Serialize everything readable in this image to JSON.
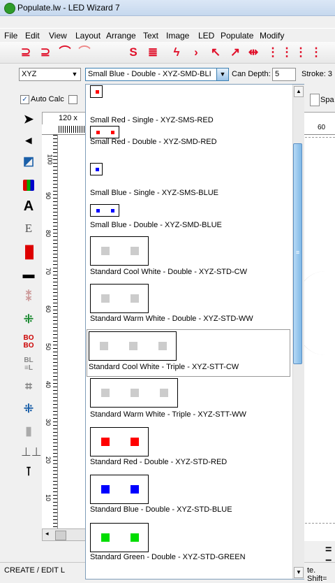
{
  "window": {
    "title": "Populate.lw - LED Wizard 7"
  },
  "menu": [
    "File",
    "Edit",
    "View",
    "Layout",
    "Arrange",
    "Text",
    "Image",
    "LED",
    "Populate",
    "Modify"
  ],
  "toolbar2": {
    "font_select": "XYZ",
    "led_select": "Small Blue - Double - XYZ-SMD-BLI",
    "can_depth_label": "Can Depth:",
    "can_depth_value": "5",
    "stroke_label": "Stroke: 3"
  },
  "toolbar3": {
    "auto_calc_label": "Auto Calc",
    "auto_calc_checked": "✓",
    "spa_label": "Spa"
  },
  "canvas": {
    "size_readout": "120 x",
    "ruler_h_label": "60",
    "ruler_v_labels": [
      "100",
      "90",
      "80",
      "70",
      "60",
      "50",
      "40",
      "30",
      "20",
      "10"
    ]
  },
  "statusbar": {
    "left_text": "CREATE / EDIT L",
    "right_text": "te. Shift="
  },
  "dropdown": {
    "options": [
      {
        "label": "Small Red - Single - XYZ-SMS-RED",
        "color": "#ff0000"
      },
      {
        "label": "Small Red - Double - XYZ-SMD-RED",
        "color": "#ff0000"
      },
      {
        "label": "Small Blue - Single - XYZ-SMS-BLUE",
        "color": "#0000ff"
      },
      {
        "label": "Small Blue - Double - XYZ-SMD-BLUE",
        "color": "#0000ff"
      },
      {
        "label": "Standard Cool White - Double - XYZ-STD-CW",
        "color": "#cccccc"
      },
      {
        "label": "Standard Warm White - Double - XYZ-STD-WW",
        "color": "#cccccc"
      },
      {
        "label": "Standard Cool White - Triple - XYZ-STT-CW",
        "color": "#cccccc"
      },
      {
        "label": "Standard Warm White - Triple - XYZ-STT-WW",
        "color": "#cccccc"
      },
      {
        "label": "Standard Red - Double - XYZ-STD-RED",
        "color": "#ff0000"
      },
      {
        "label": "Standard Blue - Double - XYZ-STD-BLUE",
        "color": "#0000ff"
      },
      {
        "label": "Standard Green - Double - XYZ-STD-GREEN",
        "color": "#00dd00"
      }
    ]
  }
}
